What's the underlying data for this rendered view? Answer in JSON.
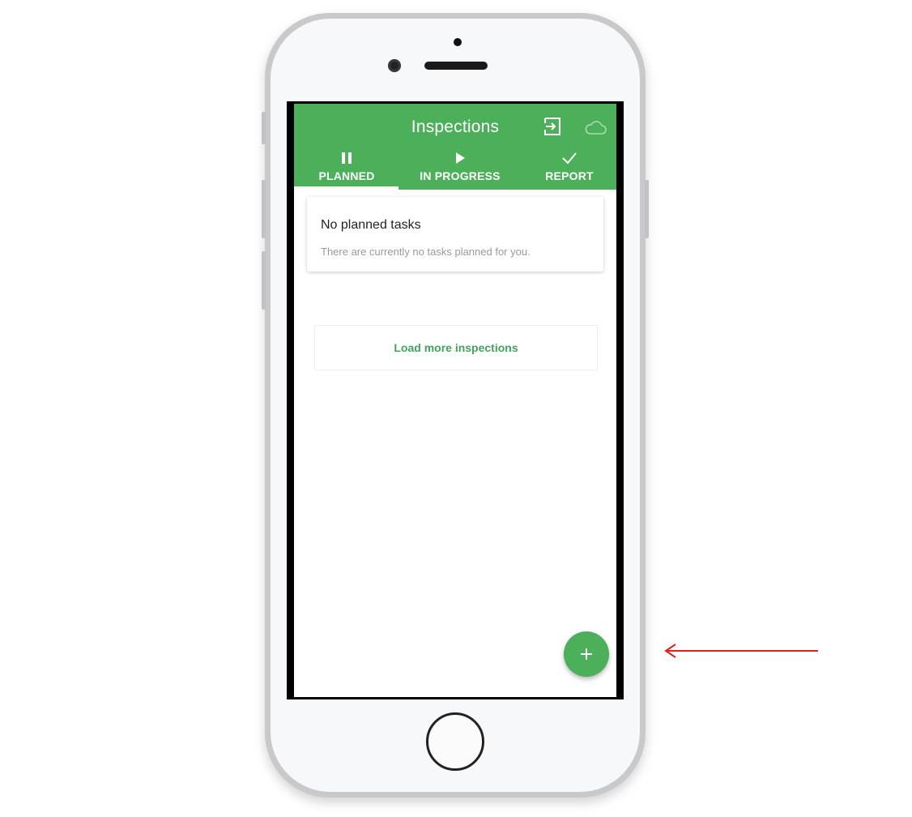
{
  "app": {
    "title": "Inspections",
    "accent_color": "#4caf5a",
    "header_icons": [
      "login-icon",
      "cloud-icon"
    ]
  },
  "tabs": [
    {
      "label": "PLANNED",
      "icon": "pause-icon",
      "active": true
    },
    {
      "label": "IN PROGRESS",
      "icon": "play-icon",
      "active": false
    },
    {
      "label": "REPORT",
      "icon": "check-icon",
      "active": false
    }
  ],
  "empty_state": {
    "title": "No planned tasks",
    "message": "There are currently no tasks planned for you."
  },
  "load_more": {
    "label": "Load more inspections"
  },
  "fab": {
    "icon": "plus-icon"
  },
  "annotation": {
    "icon": "arrow-left-icon",
    "color": "#e02020"
  }
}
